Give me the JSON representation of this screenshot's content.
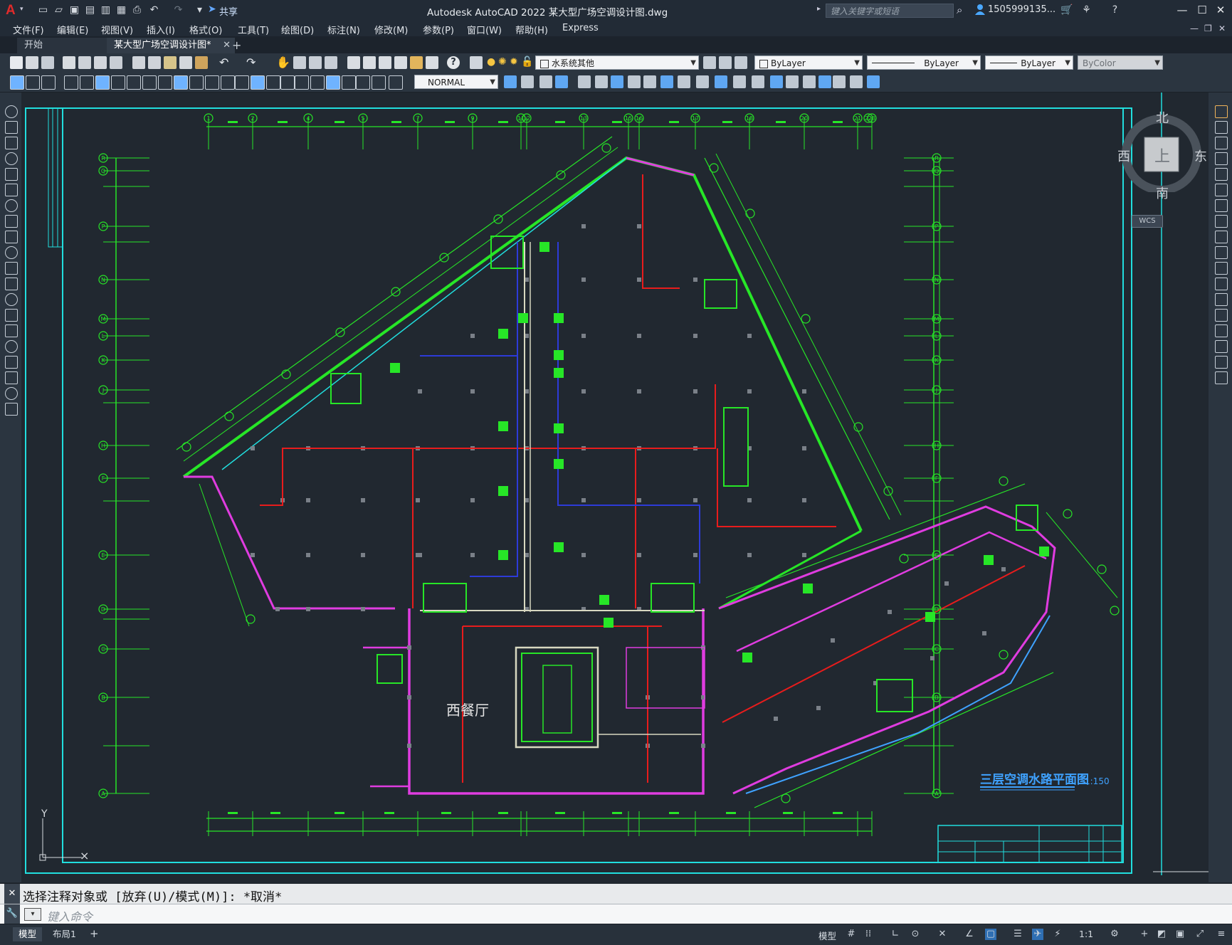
{
  "app": {
    "title": "Autodesk AutoCAD 2022    某大型广场空调设计图.dwg",
    "share_label": "共享",
    "search_placeholder": "键入关键字或短语",
    "user_name": "1505999135...",
    "logo_letter": "A"
  },
  "menu": [
    "文件(F)",
    "编辑(E)",
    "视图(V)",
    "插入(I)",
    "格式(O)",
    "工具(T)",
    "绘图(D)",
    "标注(N)",
    "修改(M)",
    "参数(P)",
    "窗口(W)",
    "帮助(H)",
    "Express"
  ],
  "tabs": {
    "start": "开始",
    "drawing": "某大型广场空调设计图*",
    "close_glyph": "✕",
    "add_glyph": "+"
  },
  "toolbar": {
    "layer_value": "水系统其他",
    "color_value": "ByLayer",
    "linetype_value": "ByLayer",
    "lineweight_value": "ByLayer",
    "plotstyle_value": "ByColor",
    "textstyle_value": "NORMAL"
  },
  "viewcube": {
    "north": "北",
    "south": "南",
    "east": "东",
    "west": "西",
    "top": "上",
    "wcs": "WCS"
  },
  "drawing": {
    "plan_title": "三层空调水路平面图",
    "scale": "1:150",
    "room_label": "西餐厅",
    "axis_y": "Y",
    "grid_numbers": [
      "1",
      "2",
      "4",
      "5",
      "7",
      "9",
      "11",
      "12",
      "13",
      "15",
      "16",
      "17",
      "18",
      "20",
      "21",
      "22",
      "23"
    ],
    "grid_letters": [
      "R",
      "Q",
      "P",
      "N",
      "M",
      "L",
      "K",
      "J",
      "H",
      "F",
      "E",
      "D",
      "C",
      "B",
      "A"
    ]
  },
  "command": {
    "history": "选择注释对象或 [放弃(U)/模式(M)]: *取消*",
    "placeholder": "键入命令"
  },
  "status": {
    "model_tab": "模型",
    "layout_tab": "布局1",
    "add_glyph": "+",
    "model_space": "模型",
    "scale": "1:1"
  },
  "colors": {
    "background": "#212830",
    "wall_magenta": "#e03ce0",
    "grid_green": "#27e627",
    "pipe_red": "#e81c1c",
    "pipe_blue": "#2d3bd8",
    "frame_cyan": "#21dede"
  }
}
